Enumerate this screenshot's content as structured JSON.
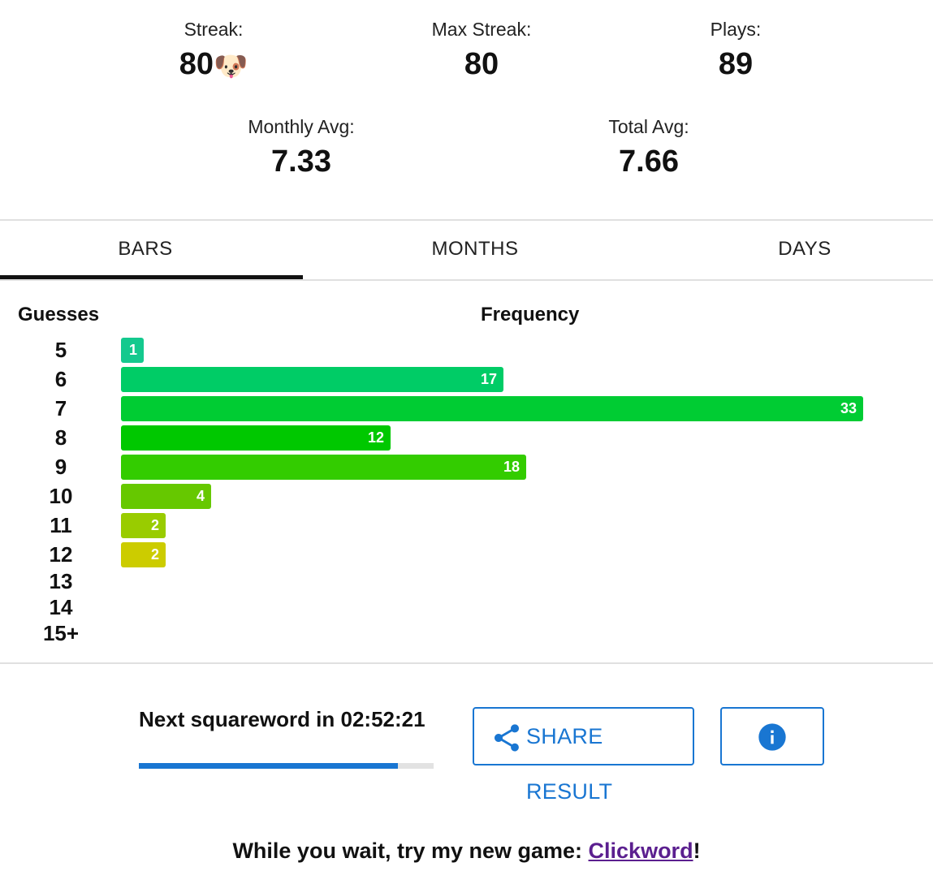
{
  "stats": {
    "streak_label": "Streak:",
    "streak_value": "80",
    "streak_emoji": "🐶",
    "max_streak_label": "Max Streak:",
    "max_streak_value": "80",
    "plays_label": "Plays:",
    "plays_value": "89",
    "monthly_avg_label": "Monthly Avg:",
    "monthly_avg_value": "7.33",
    "total_avg_label": "Total Avg:",
    "total_avg_value": "7.66"
  },
  "tabs": [
    {
      "label": "BARS",
      "active": true
    },
    {
      "label": "MONTHS",
      "active": false
    },
    {
      "label": "DAYS",
      "active": false
    }
  ],
  "chart_data": {
    "type": "bar",
    "orientation": "horizontal",
    "xlabel": "Frequency",
    "ylabel": "Guesses",
    "categories": [
      "5",
      "6",
      "7",
      "8",
      "9",
      "10",
      "11",
      "12",
      "13",
      "14",
      "15+"
    ],
    "values": [
      1,
      17,
      33,
      12,
      18,
      4,
      2,
      2,
      0,
      0,
      0
    ],
    "colors": [
      "#14c98e",
      "#00cc66",
      "#00cc33",
      "#00c800",
      "#33cc00",
      "#66c800",
      "#99cc00",
      "#cccc00"
    ],
    "data_labels": true,
    "legend": "none",
    "grid": false
  },
  "countdown": {
    "text": "Next squareword in 02:52:21",
    "progress": 0.88,
    "progress_color": "#1976d2"
  },
  "actions": {
    "share_label": "SHARE RESULT",
    "share_icon": "share-icon",
    "info_icon": "info-icon",
    "accent_color": "#1976d2"
  },
  "promo": {
    "text": "While you wait, try my new game: ",
    "link_text": "Clickword",
    "suffix": "!"
  }
}
